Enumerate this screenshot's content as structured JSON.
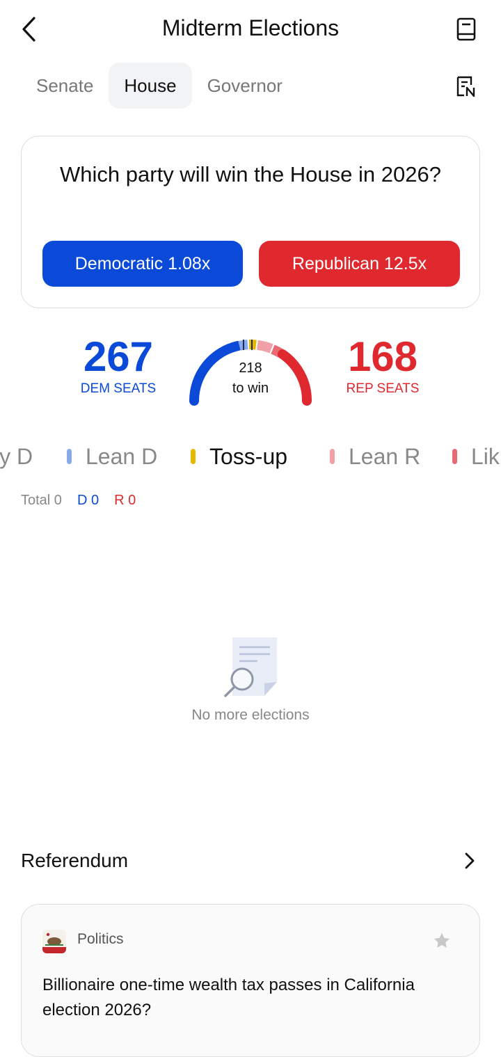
{
  "header": {
    "title": "Midterm Elections",
    "back_icon": "chevron-left-icon",
    "book_icon": "book-icon",
    "news_icon": "news-icon"
  },
  "tabs": [
    {
      "label": "Senate",
      "active": false
    },
    {
      "label": "House",
      "active": true
    },
    {
      "label": "Governor",
      "active": false
    }
  ],
  "question": {
    "text": "Which party will win the House in 2026?",
    "dem_button": "Democratic 1.08x",
    "rep_button": "Republican 12.5x"
  },
  "seats": {
    "dem_count": "267",
    "dem_label": "DEM SEATS",
    "rep_count": "168",
    "rep_label": "REP SEATS",
    "to_win_number": "218",
    "to_win_label": "to win"
  },
  "ratings": [
    {
      "label": "ly D",
      "color": "#0b4ad8"
    },
    {
      "label": "Lean D",
      "color": "#8aa9ec"
    },
    {
      "label": "Toss-up",
      "color": "#e6b800",
      "active": true
    },
    {
      "label": "Lean R",
      "color": "#f0a0a6"
    },
    {
      "label": "Lik",
      "color": "#e86a72"
    }
  ],
  "totals": {
    "total": "Total 0",
    "dem": "D 0",
    "rep": "R 0"
  },
  "empty_state": {
    "icon": "document-search-icon",
    "text": "No more elections"
  },
  "referendum": {
    "title": "Referendum",
    "chevron_icon": "chevron-right-icon",
    "card": {
      "category": "Politics",
      "question": "Billionaire one-time wealth tax passes in California election 2026?",
      "flag_icon": "california-flag-icon",
      "star_icon": "star-icon"
    }
  },
  "colors": {
    "dem": "#0b4ad8",
    "rep": "#e0282f"
  }
}
